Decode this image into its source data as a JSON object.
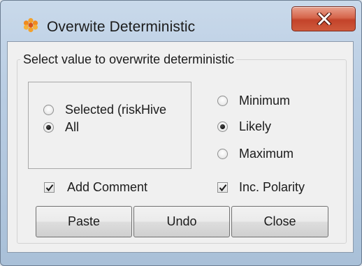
{
  "window": {
    "title": "Overwite Deterministic",
    "icon": "orange-flower-icon",
    "close_icon": "close-x-icon",
    "colors": {
      "title_bar": "#b9cde3",
      "close_button": "#c3432a",
      "client_bg": "#f0f0f0"
    }
  },
  "group": {
    "legend": "Select value to overwrite deterministic"
  },
  "scope_options": {
    "selected_label": "Selected (riskHive",
    "all_label": "All",
    "selected_value": "All"
  },
  "value_options": {
    "minimum_label": "Minimum",
    "likely_label": "Likely",
    "maximum_label": "Maximum",
    "selected_value": "Likely"
  },
  "checkboxes": {
    "add_comment_label": "Add Comment",
    "add_comment_checked": true,
    "inc_polarity_label": "Inc. Polarity",
    "inc_polarity_checked": true
  },
  "buttons": {
    "paste_label": "Paste",
    "undo_label": "Undo",
    "close_label": "Close"
  }
}
